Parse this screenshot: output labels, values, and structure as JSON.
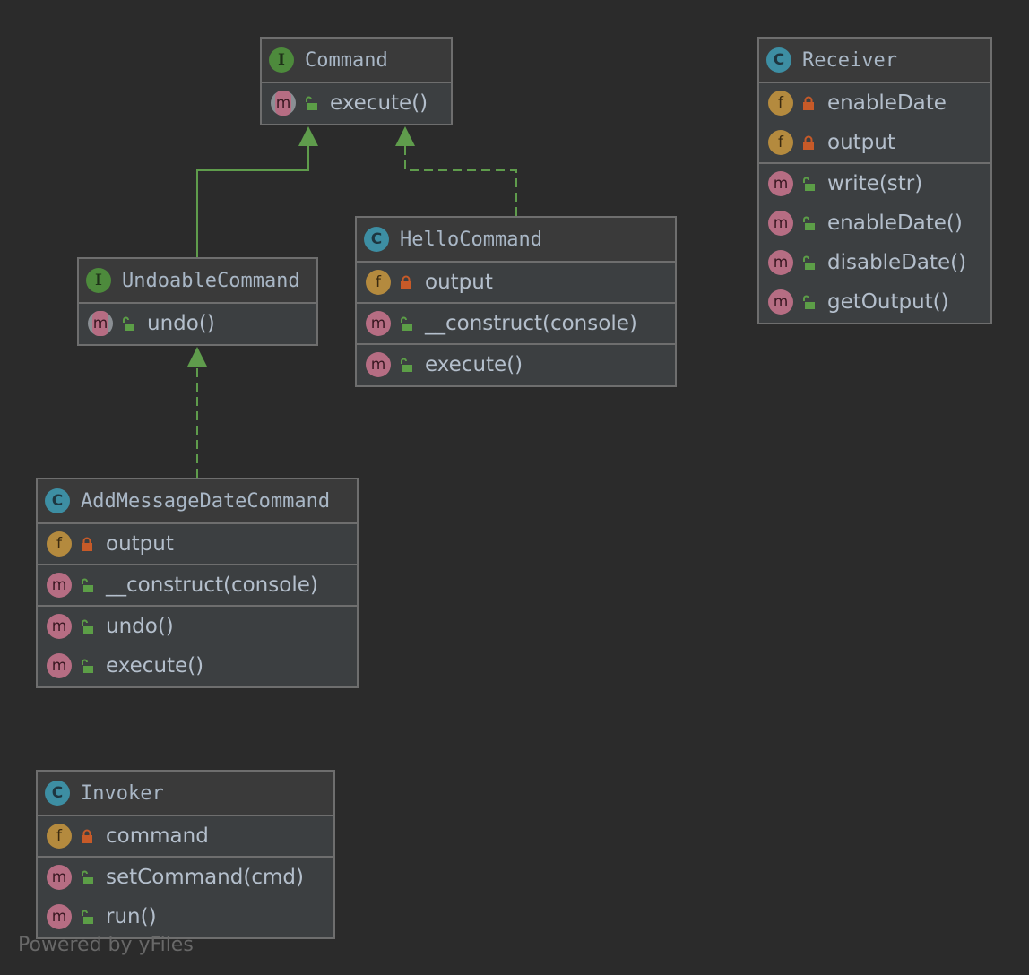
{
  "diagram": {
    "watermark": "Powered by yFiles",
    "colors": {
      "background": "#2b2b2b",
      "node_border": "#6e6e6e",
      "edge": "#5f9c4c",
      "class_badge": "#3d8ea3",
      "interface_badge": "#4d8a3c",
      "field_badge": "#b48a3e",
      "method_badge": "#b66d83",
      "private_lock": "#c75a28",
      "public_lock": "#5c9e47"
    },
    "nodes": {
      "command": {
        "kind": "interface",
        "kind_letter": "I",
        "name": "Command",
        "sections": [
          [
            {
              "type": "abstract-method",
              "visibility": "public",
              "badge": "m",
              "label": "execute()"
            }
          ]
        ]
      },
      "receiver": {
        "kind": "class",
        "kind_letter": "C",
        "name": "Receiver",
        "sections": [
          [
            {
              "type": "field",
              "visibility": "private",
              "badge": "f",
              "label": "enableDate"
            },
            {
              "type": "field",
              "visibility": "private",
              "badge": "f",
              "label": "output"
            }
          ],
          [
            {
              "type": "method",
              "visibility": "public",
              "badge": "m",
              "label": "write(str)"
            },
            {
              "type": "method",
              "visibility": "public",
              "badge": "m",
              "label": "enableDate()"
            },
            {
              "type": "method",
              "visibility": "public",
              "badge": "m",
              "label": "disableDate()"
            },
            {
              "type": "method",
              "visibility": "public",
              "badge": "m",
              "label": "getOutput()"
            }
          ]
        ]
      },
      "hello_command": {
        "kind": "class",
        "kind_letter": "C",
        "name": "HelloCommand",
        "sections": [
          [
            {
              "type": "field",
              "visibility": "private",
              "badge": "f",
              "label": "output"
            }
          ],
          [
            {
              "type": "method",
              "visibility": "public",
              "badge": "m",
              "label": "__construct(console)"
            }
          ],
          [
            {
              "type": "method",
              "visibility": "public",
              "badge": "m",
              "label": "execute()"
            }
          ]
        ]
      },
      "undoable_command": {
        "kind": "interface",
        "kind_letter": "I",
        "name": "UndoableCommand",
        "sections": [
          [
            {
              "type": "abstract-method",
              "visibility": "public",
              "badge": "m",
              "label": "undo()"
            }
          ]
        ]
      },
      "add_message_date_command": {
        "kind": "class",
        "kind_letter": "C",
        "name": "AddMessageDateCommand",
        "sections": [
          [
            {
              "type": "field",
              "visibility": "private",
              "badge": "f",
              "label": "output"
            }
          ],
          [
            {
              "type": "method",
              "visibility": "public",
              "badge": "m",
              "label": "__construct(console)"
            }
          ],
          [
            {
              "type": "method",
              "visibility": "public",
              "badge": "m",
              "label": "undo()"
            },
            {
              "type": "method",
              "visibility": "public",
              "badge": "m",
              "label": "execute()"
            }
          ]
        ]
      },
      "invoker": {
        "kind": "class",
        "kind_letter": "C",
        "name": "Invoker",
        "sections": [
          [
            {
              "type": "field",
              "visibility": "private",
              "badge": "f",
              "label": "command"
            }
          ],
          [
            {
              "type": "method",
              "visibility": "public",
              "badge": "m",
              "label": "setCommand(cmd)"
            },
            {
              "type": "method",
              "visibility": "public",
              "badge": "m",
              "label": "run()"
            }
          ]
        ]
      }
    },
    "edges": [
      {
        "from": "undoable_command",
        "to": "command",
        "relation": "extends",
        "style": "solid"
      },
      {
        "from": "hello_command",
        "to": "command",
        "relation": "implements",
        "style": "dashed"
      },
      {
        "from": "add_message_date_command",
        "to": "undoable_command",
        "relation": "implements",
        "style": "dashed"
      }
    ]
  }
}
